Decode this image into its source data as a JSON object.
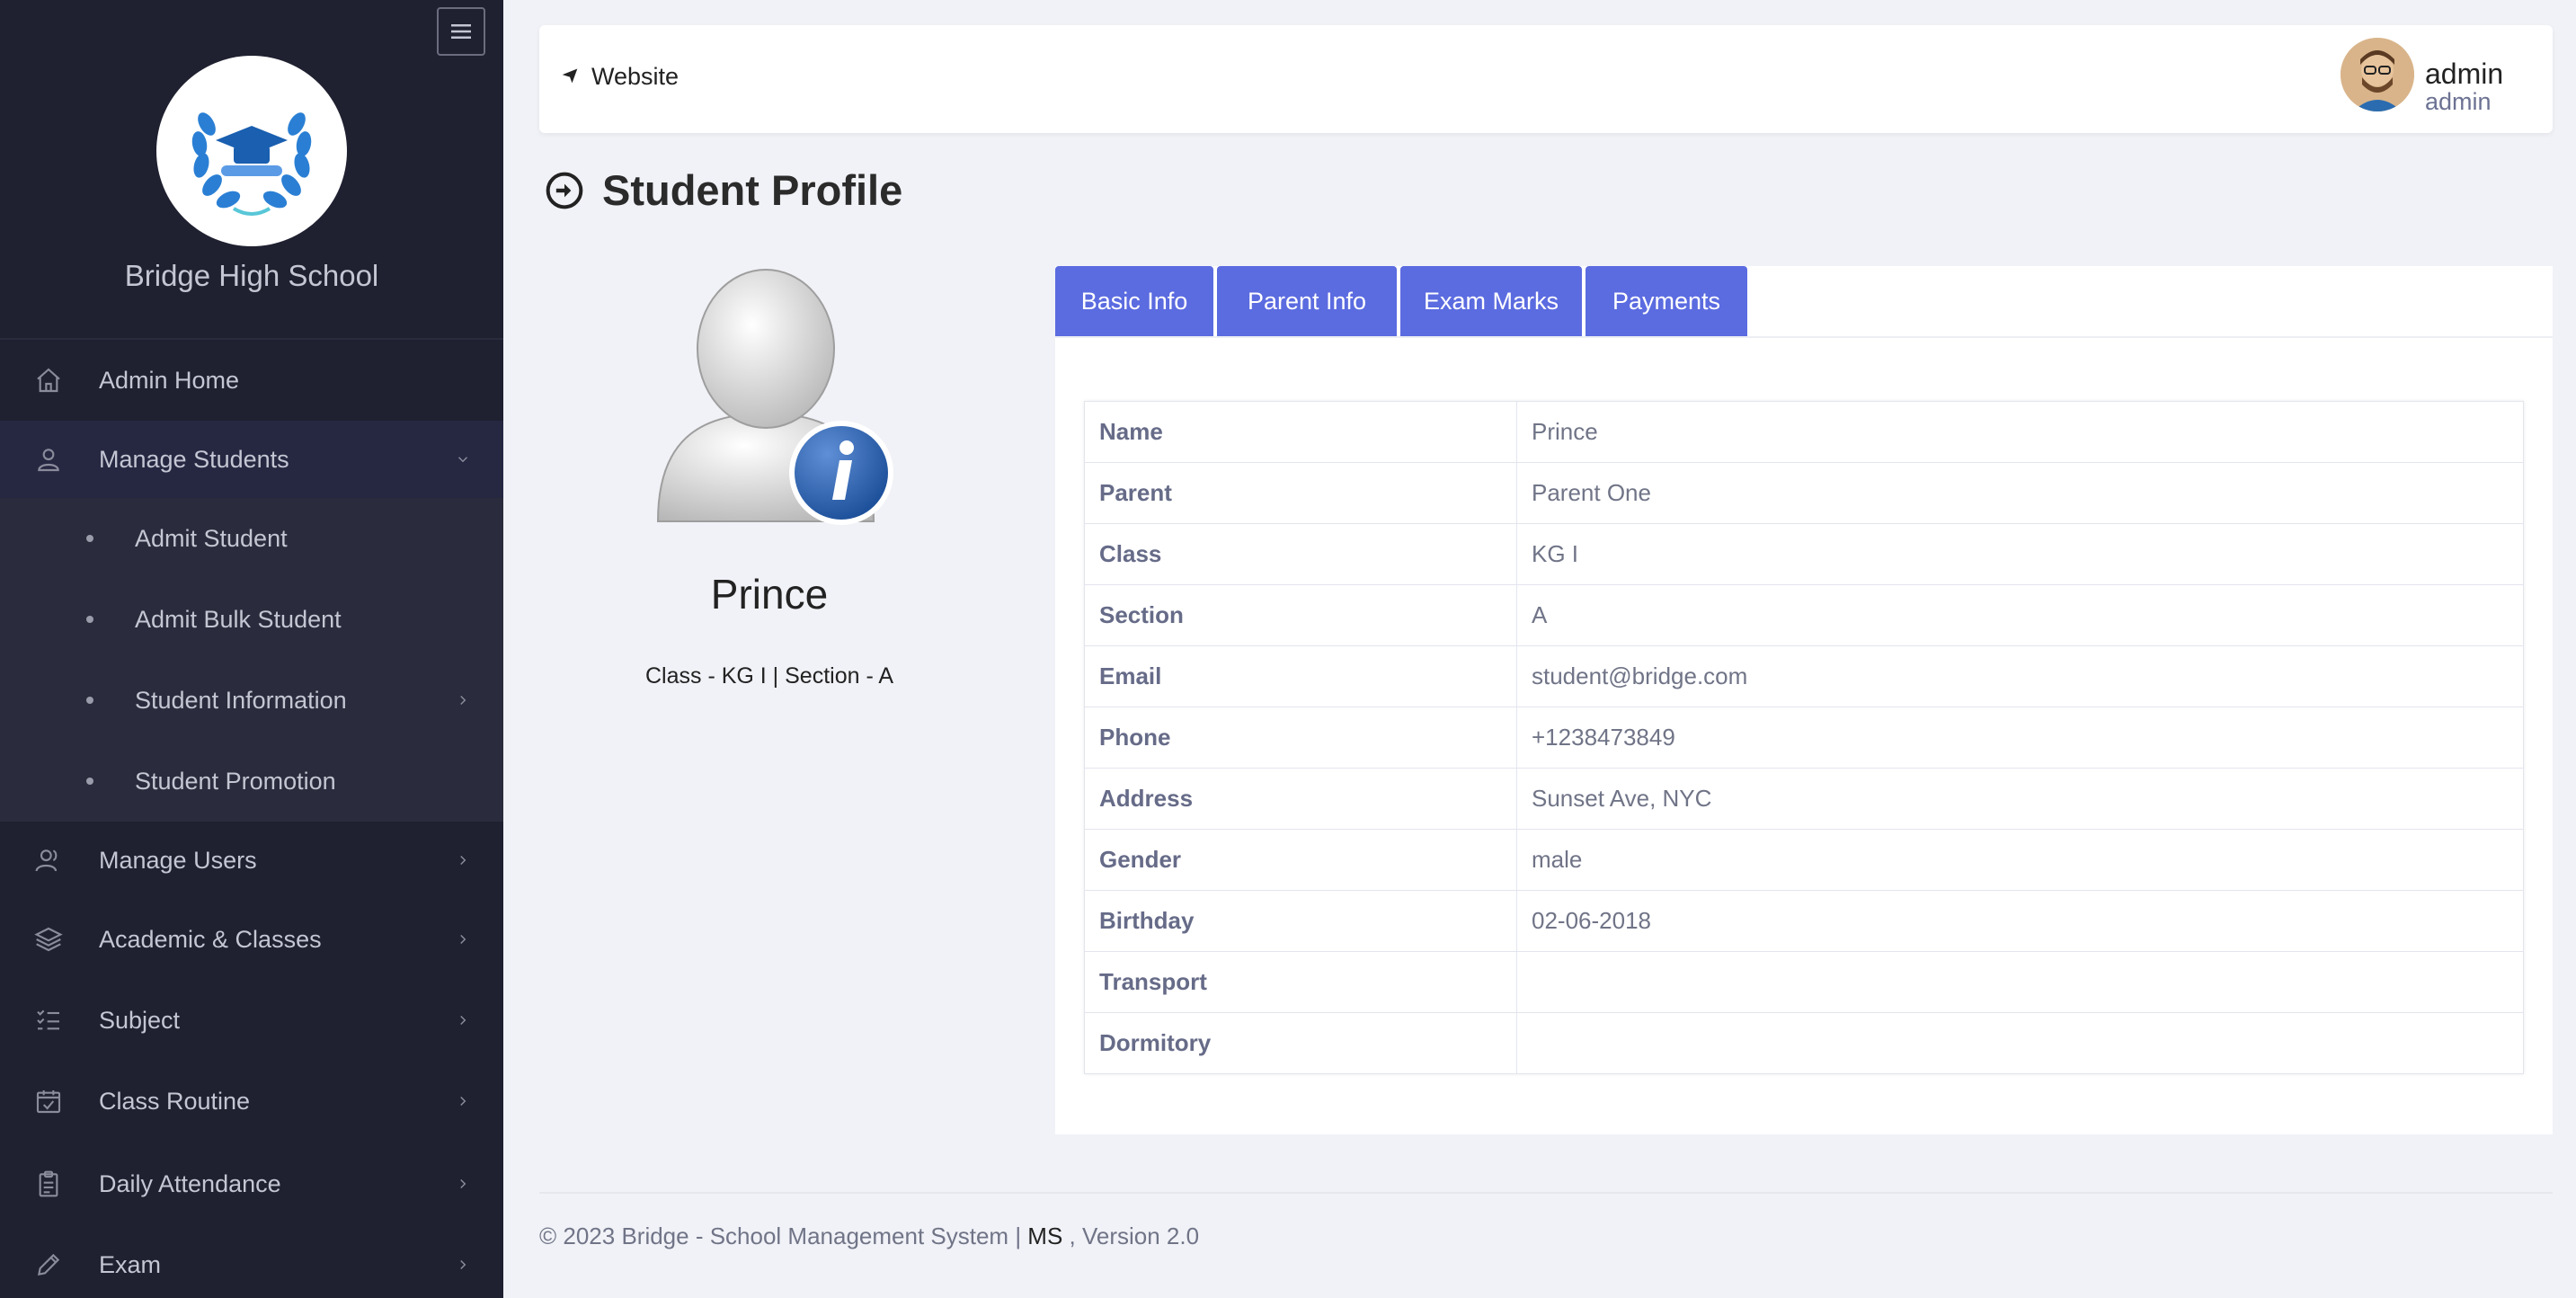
{
  "sidebar": {
    "school_name": "Bridge High School",
    "items": [
      {
        "label": "Admin Home",
        "icon": "home-icon"
      },
      {
        "label": "Manage Students",
        "icon": "user-icon",
        "expanded": true
      },
      {
        "label": "Manage Users",
        "icon": "users-icon"
      },
      {
        "label": "Academic & Classes",
        "icon": "layers-icon"
      },
      {
        "label": "Subject",
        "icon": "checklist-icon"
      },
      {
        "label": "Class Routine",
        "icon": "calendar-check-icon"
      },
      {
        "label": "Daily Attendance",
        "icon": "clipboard-icon"
      },
      {
        "label": "Exam",
        "icon": "pencil-icon"
      }
    ],
    "submenu": [
      {
        "label": "Admit Student"
      },
      {
        "label": "Admit Bulk Student"
      },
      {
        "label": "Student Information"
      },
      {
        "label": "Student Promotion"
      }
    ]
  },
  "header": {
    "website_label": "Website",
    "user_name": "admin",
    "user_role": "admin"
  },
  "page": {
    "title": "Student Profile"
  },
  "profile": {
    "name": "Prince",
    "class_section": "Class - KG I | Section - A"
  },
  "tabs": [
    "Basic Info",
    "Parent Info",
    "Exam Marks",
    "Payments"
  ],
  "basic_info": [
    {
      "label": "Name",
      "value": "Prince"
    },
    {
      "label": "Parent",
      "value": "Parent One"
    },
    {
      "label": "Class",
      "value": "KG I"
    },
    {
      "label": "Section",
      "value": "A"
    },
    {
      "label": "Email",
      "value": "student@bridge.com"
    },
    {
      "label": "Phone",
      "value": "+1238473849"
    },
    {
      "label": "Address",
      "value": "Sunset Ave, NYC"
    },
    {
      "label": "Gender",
      "value": "male"
    },
    {
      "label": "Birthday",
      "value": "02-06-2018"
    },
    {
      "label": "Transport",
      "value": ""
    },
    {
      "label": "Dormitory",
      "value": ""
    }
  ],
  "footer": {
    "text": "© 2023 Bridge - School Management System | ",
    "ms": "MS",
    "version": " , Version 2.0"
  },
  "colors": {
    "sidebar_bg": "#1f2030",
    "tab_bg": "#5b6be0",
    "page_bg": "#f1f2f7"
  }
}
